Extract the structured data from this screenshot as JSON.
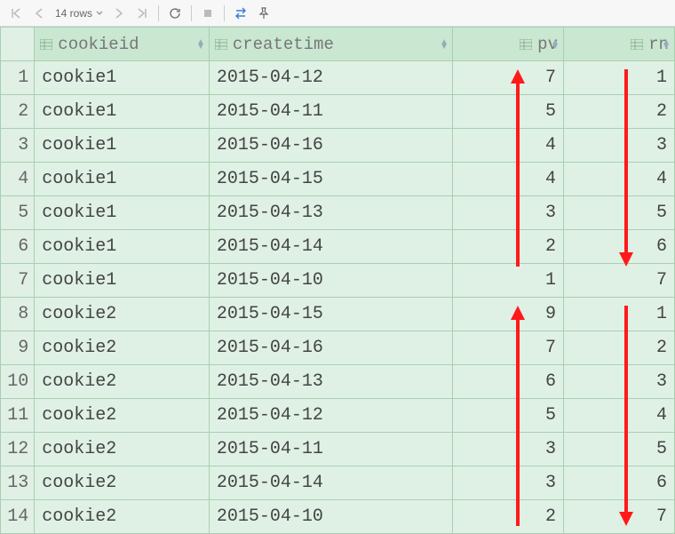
{
  "toolbar": {
    "rows_label": "14 rows"
  },
  "columns": [
    {
      "name": "cookieid",
      "align": "left"
    },
    {
      "name": "createtime",
      "align": "left"
    },
    {
      "name": "pv",
      "align": "right"
    },
    {
      "name": "rn",
      "align": "right"
    }
  ],
  "rows": [
    {
      "n": "1",
      "cookieid": "cookie1",
      "createtime": "2015-04-12",
      "pv": "7",
      "rn": "1"
    },
    {
      "n": "2",
      "cookieid": "cookie1",
      "createtime": "2015-04-11",
      "pv": "5",
      "rn": "2"
    },
    {
      "n": "3",
      "cookieid": "cookie1",
      "createtime": "2015-04-16",
      "pv": "4",
      "rn": "3"
    },
    {
      "n": "4",
      "cookieid": "cookie1",
      "createtime": "2015-04-15",
      "pv": "4",
      "rn": "4"
    },
    {
      "n": "5",
      "cookieid": "cookie1",
      "createtime": "2015-04-13",
      "pv": "3",
      "rn": "5"
    },
    {
      "n": "6",
      "cookieid": "cookie1",
      "createtime": "2015-04-14",
      "pv": "2",
      "rn": "6"
    },
    {
      "n": "7",
      "cookieid": "cookie1",
      "createtime": "2015-04-10",
      "pv": "1",
      "rn": "7"
    },
    {
      "n": "8",
      "cookieid": "cookie2",
      "createtime": "2015-04-15",
      "pv": "9",
      "rn": "1"
    },
    {
      "n": "9",
      "cookieid": "cookie2",
      "createtime": "2015-04-16",
      "pv": "7",
      "rn": "2"
    },
    {
      "n": "10",
      "cookieid": "cookie2",
      "createtime": "2015-04-13",
      "pv": "6",
      "rn": "3"
    },
    {
      "n": "11",
      "cookieid": "cookie2",
      "createtime": "2015-04-12",
      "pv": "5",
      "rn": "4"
    },
    {
      "n": "12",
      "cookieid": "cookie2",
      "createtime": "2015-04-11",
      "pv": "3",
      "rn": "5"
    },
    {
      "n": "13",
      "cookieid": "cookie2",
      "createtime": "2015-04-14",
      "pv": "3",
      "rn": "6"
    },
    {
      "n": "14",
      "cookieid": "cookie2",
      "createtime": "2015-04-10",
      "pv": "2",
      "rn": "7"
    }
  ],
  "annotation_color": "#ff1a1a"
}
